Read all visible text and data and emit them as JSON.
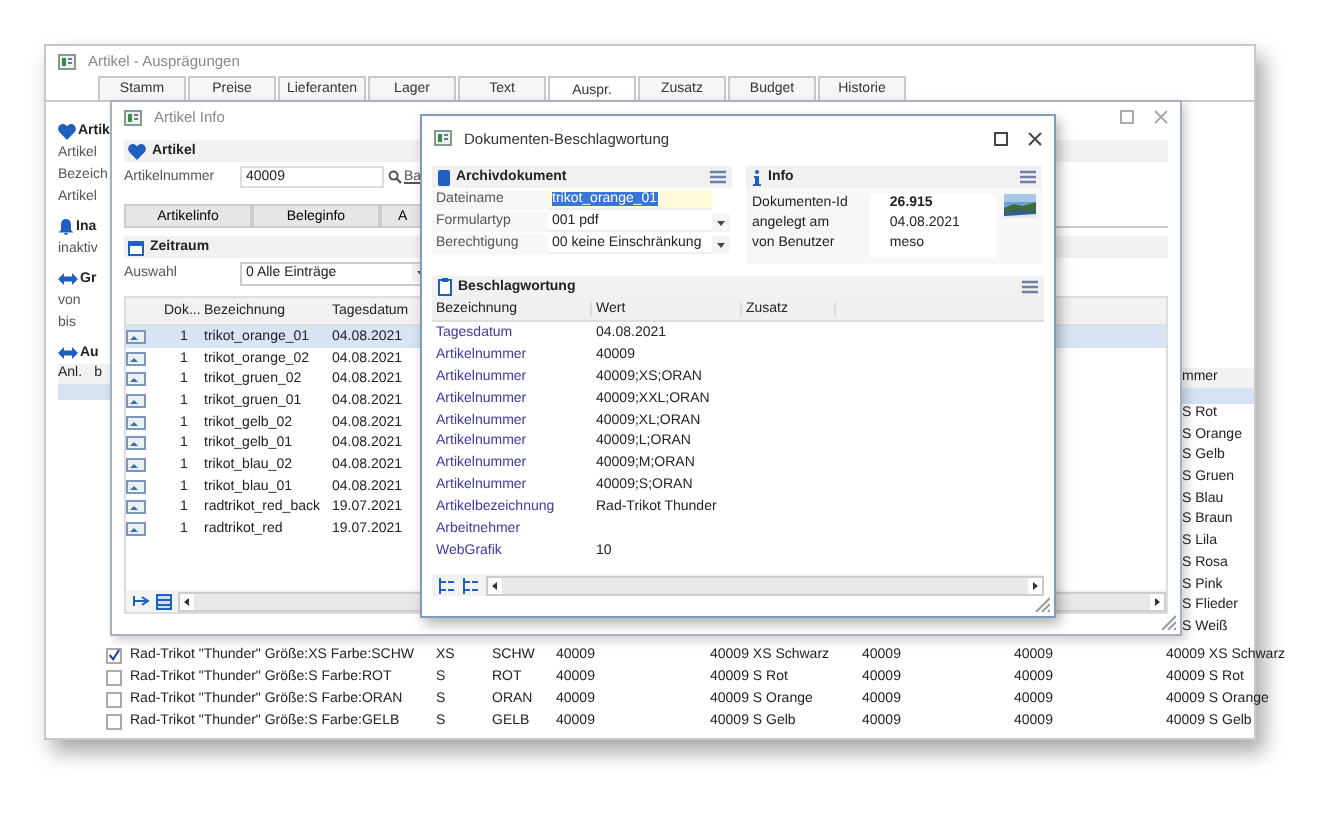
{
  "main_window": {
    "title": "Artikel - Ausprägungen",
    "tabs": [
      {
        "label": "Stamm",
        "selected": false
      },
      {
        "label": "Preise",
        "selected": false
      },
      {
        "label": "Lieferanten",
        "selected": false
      },
      {
        "label": "Lager",
        "selected": false
      },
      {
        "label": "Text",
        "selected": false
      },
      {
        "label": "Auspr.",
        "selected": true
      },
      {
        "label": "Zusatz",
        "selected": false
      },
      {
        "label": "Budget",
        "selected": false
      },
      {
        "label": "Historie",
        "selected": false
      }
    ],
    "left_sections": [
      {
        "title": "Artik",
        "rows": [
          "Artikel",
          "Bezeich",
          "Artikel"
        ]
      },
      {
        "title": "Ina",
        "rows": [
          "inaktiv"
        ]
      },
      {
        "title": "Gr",
        "rows": [
          "von",
          "bis"
        ]
      },
      {
        "title": "Au",
        "columns": [
          "Anl.",
          "b"
        ]
      }
    ],
    "highlighted_row": {
      "selected": true
    },
    "right_column": {
      "header": "mmer",
      "rows": [
        "S Rot",
        "S Orange",
        "S Gelb",
        "S Gruen",
        "S Blau",
        "S Braun",
        "S Lila",
        "S Rosa",
        "S Pink",
        "S Flieder",
        "S Weiß"
      ]
    },
    "bottom_rows": [
      {
        "checked": true,
        "cells": [
          "Rad-Trikot \"Thunder\" Größe:XS Farbe:SCHW",
          "XS",
          "SCHW",
          "40009",
          "40009 XS Schwarz",
          "40009",
          "40009",
          "40009 XS Schwarz"
        ]
      },
      {
        "checked": false,
        "cells": [
          "Rad-Trikot \"Thunder\" Größe:S Farbe:ROT",
          "S",
          "ROT",
          "40009",
          "40009 S Rot",
          "40009",
          "40009",
          "40009 S Rot"
        ]
      },
      {
        "checked": false,
        "cells": [
          "Rad-Trikot \"Thunder\" Größe:S Farbe:ORAN",
          "S",
          "ORAN",
          "40009",
          "40009 S Orange",
          "40009",
          "40009",
          "40009 S Orange"
        ]
      },
      {
        "checked": false,
        "cells": [
          "Rad-Trikot \"Thunder\" Größe:S Farbe:GELB",
          "S",
          "GELB",
          "40009",
          "40009 S Gelb",
          "40009",
          "40009",
          "40009 S Gelb"
        ]
      }
    ]
  },
  "artikel_info": {
    "title": "Artikel Info",
    "section": "Artikel",
    "field_label": "Artikelnummer",
    "field_value": "40009",
    "link": "Ba",
    "tabs": [
      {
        "label": "Artikelinfo",
        "selected": false
      },
      {
        "label": "Beleginfo",
        "selected": false
      },
      {
        "label": "A",
        "selected": false
      }
    ],
    "zeitraum": {
      "title": "Zeitraum",
      "label": "Auswahl",
      "value": "0 Alle Einträge"
    },
    "table": {
      "columns": [
        "Dok...",
        "Bezeichnung",
        "Tagesdatum"
      ],
      "rows": [
        {
          "selected": true,
          "count": "1",
          "name": "trikot_orange_01",
          "date": "04.08.2021"
        },
        {
          "selected": false,
          "count": "1",
          "name": "trikot_orange_02",
          "date": "04.08.2021"
        },
        {
          "selected": false,
          "count": "1",
          "name": "trikot_gruen_02",
          "date": "04.08.2021"
        },
        {
          "selected": false,
          "count": "1",
          "name": "trikot_gruen_01",
          "date": "04.08.2021"
        },
        {
          "selected": false,
          "count": "1",
          "name": "trikot_gelb_02",
          "date": "04.08.2021"
        },
        {
          "selected": false,
          "count": "1",
          "name": "trikot_gelb_01",
          "date": "04.08.2021"
        },
        {
          "selected": false,
          "count": "1",
          "name": "trikot_blau_02",
          "date": "04.08.2021"
        },
        {
          "selected": false,
          "count": "1",
          "name": "trikot_blau_01",
          "date": "04.08.2021"
        },
        {
          "selected": false,
          "count": "1",
          "name": "radtrikot_red_back",
          "date": "19.07.2021"
        },
        {
          "selected": false,
          "count": "1",
          "name": "radtrikot_red",
          "date": "19.07.2021"
        }
      ]
    }
  },
  "dokumente": {
    "title": "Dokumenten-Beschlagwortung",
    "archiv": {
      "title": "Archivdokument",
      "fields": [
        {
          "kind": "text",
          "label": "Dateiname",
          "value": "trikot_orange_01",
          "selected": true
        },
        {
          "kind": "select",
          "label": "Formulartyp",
          "value": "001 pdf"
        },
        {
          "kind": "select",
          "label": "Berechtigung",
          "value": "00 keine Einschränkung"
        }
      ]
    },
    "info": {
      "title": "Info",
      "rows": [
        {
          "label": "Dokumenten-Id",
          "value": "26.915",
          "bold": true
        },
        {
          "label": "angelegt am",
          "value": "04.08.2021",
          "bold": false
        },
        {
          "label": "von Benutzer",
          "value": "meso",
          "bold": false
        }
      ]
    },
    "beschlagwortung": {
      "title": "Beschlagwortung",
      "columns": [
        "Bezeichnung",
        "Wert",
        "Zusatz"
      ],
      "rows": [
        {
          "name": "Tagesdatum",
          "value": "04.08.2021"
        },
        {
          "name": "Artikelnummer",
          "value": "40009"
        },
        {
          "name": "Artikelnummer",
          "value": "40009;XS;ORAN"
        },
        {
          "name": "Artikelnummer",
          "value": "40009;XXL;ORAN"
        },
        {
          "name": "Artikelnummer",
          "value": "40009;XL;ORAN"
        },
        {
          "name": "Artikelnummer",
          "value": "40009;L;ORAN"
        },
        {
          "name": "Artikelnummer",
          "value": "40009;M;ORAN"
        },
        {
          "name": "Artikelnummer",
          "value": "40009;S;ORAN"
        },
        {
          "name": "Artikelbezeichnung",
          "value": "Rad-Trikot Thunder"
        },
        {
          "name": "Arbeitnehmer"
        },
        {
          "name": "WebGrafik",
          "value": "10"
        }
      ]
    }
  }
}
